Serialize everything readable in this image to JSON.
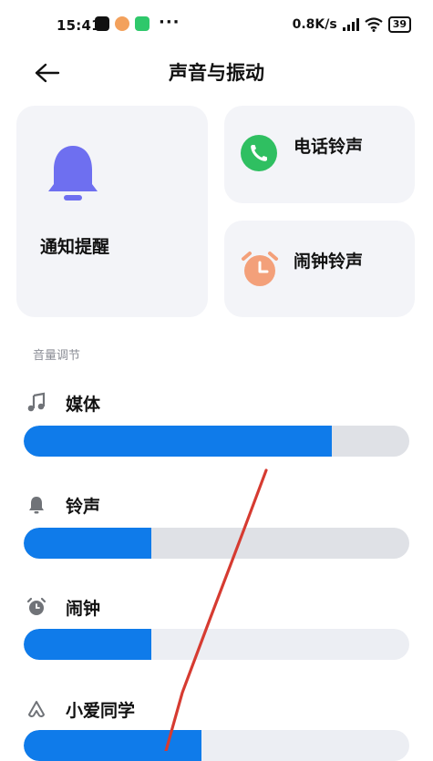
{
  "status_bar": {
    "time": "15:41",
    "more": "···",
    "network_speed": "0.8K/s",
    "battery": "39"
  },
  "header": {
    "title": "声音与振动"
  },
  "cards": {
    "notify": {
      "label": "通知提醒",
      "icon": "bell-icon",
      "color": "#6e6ff0"
    },
    "phone": {
      "label": "电话铃声",
      "icon": "phone-icon",
      "color": "#2fbf61"
    },
    "alarm": {
      "label": "闹钟铃声",
      "icon": "alarm-clock-icon",
      "color": "#f3a07a"
    }
  },
  "volume": {
    "section_title": "音量调节",
    "rows": [
      {
        "label": "媒体",
        "icon": "music-note-icon",
        "level": 0.8
      },
      {
        "label": "铃声",
        "icon": "bell-icon",
        "level": 0.33
      },
      {
        "label": "闹钟",
        "icon": "alarm-clock-icon",
        "level": 0.33
      },
      {
        "label": "小爱同学",
        "icon": "xiaoai-icon",
        "level": 0.46
      }
    ]
  },
  "colors": {
    "accent": "#0f7bea",
    "card_bg": "#f3f4f8",
    "annotation": "#d63b31"
  }
}
